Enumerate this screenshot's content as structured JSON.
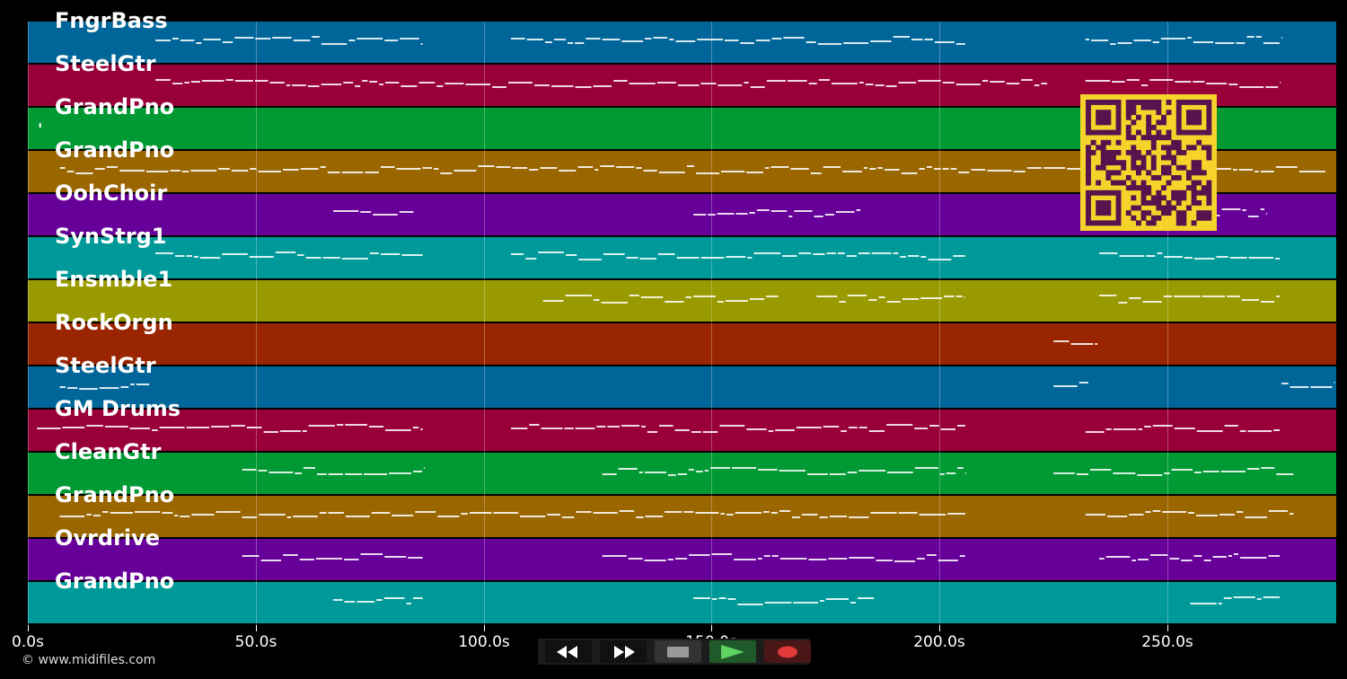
{
  "tracks": [
    {
      "name": "FngrBass",
      "color": "#006699",
      "notes": [
        [
          28,
          87
        ],
        [
          106,
          206
        ],
        [
          232,
          275
        ]
      ]
    },
    {
      "name": "SteelGtr",
      "color": "#99003a",
      "notes": [
        [
          28,
          224
        ],
        [
          232,
          275
        ]
      ]
    },
    {
      "name": "GrandPno",
      "color": "#009933",
      "notes": [
        [
          2.5,
          3
        ]
      ]
    },
    {
      "name": "GrandPno",
      "color": "#996600",
      "notes": [
        [
          7,
          285
        ]
      ]
    },
    {
      "name": "OohChoir",
      "color": "#660099",
      "notes": [
        [
          67,
          85
        ],
        [
          146,
          183
        ],
        [
          255,
          272
        ]
      ]
    },
    {
      "name": "SynStrg1",
      "color": "#009999",
      "notes": [
        [
          28,
          87
        ],
        [
          106,
          206
        ],
        [
          235,
          275
        ]
      ]
    },
    {
      "name": "Ensmble1",
      "color": "#999900",
      "notes": [
        [
          113,
          165
        ],
        [
          173,
          206
        ],
        [
          235,
          275
        ]
      ]
    },
    {
      "name": "RockOrgn",
      "color": "#992600",
      "notes": [
        [
          225,
          235
        ]
      ]
    },
    {
      "name": "SteelGtr",
      "color": "#006699",
      "notes": [
        [
          7,
          27
        ],
        [
          225,
          233
        ],
        [
          275,
          287
        ]
      ]
    },
    {
      "name": "GM Drums",
      "color": "#99003a",
      "notes": [
        [
          2,
          87
        ],
        [
          106,
          206
        ],
        [
          232,
          275
        ]
      ]
    },
    {
      "name": "CleanGtr",
      "color": "#009933",
      "notes": [
        [
          47,
          87
        ],
        [
          126,
          206
        ],
        [
          225,
          278
        ]
      ]
    },
    {
      "name": "GrandPno",
      "color": "#996600",
      "notes": [
        [
          7,
          47
        ],
        [
          47,
          206
        ],
        [
          232,
          278
        ]
      ]
    },
    {
      "name": "Ovrdrive",
      "color": "#660099",
      "notes": [
        [
          47,
          87
        ],
        [
          126,
          206
        ],
        [
          235,
          275
        ]
      ]
    },
    {
      "name": "GrandPno",
      "color": "#009999",
      "notes": [
        [
          67,
          87
        ],
        [
          146,
          186
        ],
        [
          255,
          275
        ]
      ]
    }
  ],
  "timeline": {
    "max_seconds": 287,
    "ticks": [
      0,
      50,
      100,
      150,
      200,
      250
    ],
    "tick_labels": [
      "0.0s",
      "50.0s",
      "100.0s",
      "150.0s",
      "200.0s",
      "250.0s"
    ]
  },
  "copyright": "© www.midifiles.com",
  "qr_colors": {
    "bg": "#f5d32a",
    "fg": "#55144d"
  },
  "transport": {
    "buttons": [
      {
        "name": "rewind-button",
        "icon": "rewind-icon",
        "bg": "#111111"
      },
      {
        "name": "fast-forward-button",
        "icon": "fast-forward-icon",
        "bg": "#111111"
      },
      {
        "name": "stop-button",
        "icon": "stop-icon",
        "bg": "#333333"
      },
      {
        "name": "play-button",
        "icon": "play-icon",
        "bg": "#1f5a2a"
      },
      {
        "name": "record-button",
        "icon": "record-icon",
        "bg": "#4a1616"
      }
    ]
  }
}
